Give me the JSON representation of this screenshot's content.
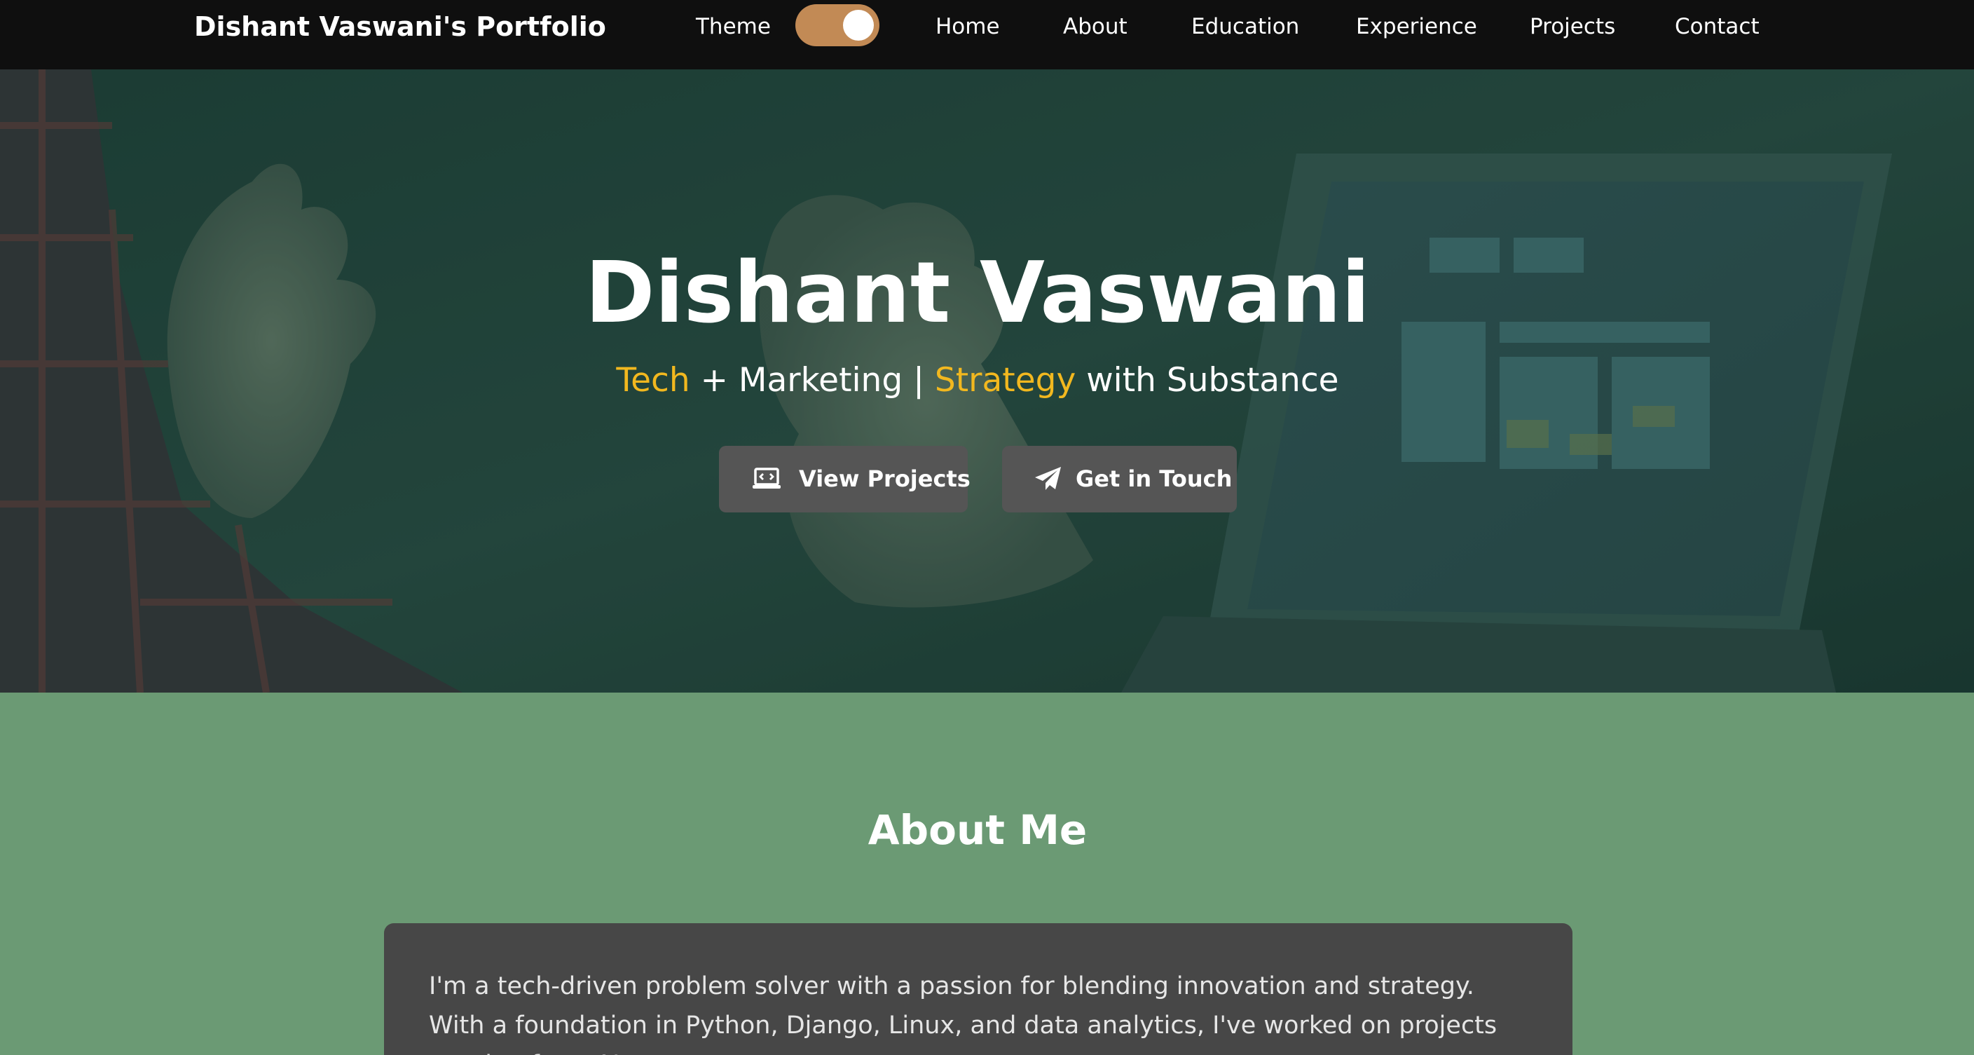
{
  "navbar": {
    "brand": "Dishant Vaswani's Portfolio",
    "theme_label": "Theme",
    "theme_toggle_on": true,
    "links": [
      "Home",
      "About",
      "Education",
      "Experience",
      "Projects",
      "Contact"
    ]
  },
  "hero": {
    "name": "Dishant Vaswani",
    "subtitle": {
      "part1": "Tech",
      "part2": " + Marketing | ",
      "part3": "Strategy",
      "part4": " with Substance"
    },
    "buttons": {
      "projects_label": "View Projects",
      "projects_icon": "laptop-code-icon",
      "contact_label": "Get in Touch",
      "contact_icon": "paper-plane-icon"
    }
  },
  "about": {
    "heading": "About Me",
    "text": "I'm a tech-driven problem solver with a passion for blending innovation and strategy. With a foundation in Python, Django, Linux, and data analytics, I've worked on projects ranging from AI-"
  },
  "colors": {
    "navbar_bg": "#0f0f0f",
    "toggle_bg": "#c28a55",
    "accent": "#f2b81f",
    "button_bg": "#555555",
    "about_bg": "#6b9a74",
    "about_card_bg": "#474747"
  }
}
